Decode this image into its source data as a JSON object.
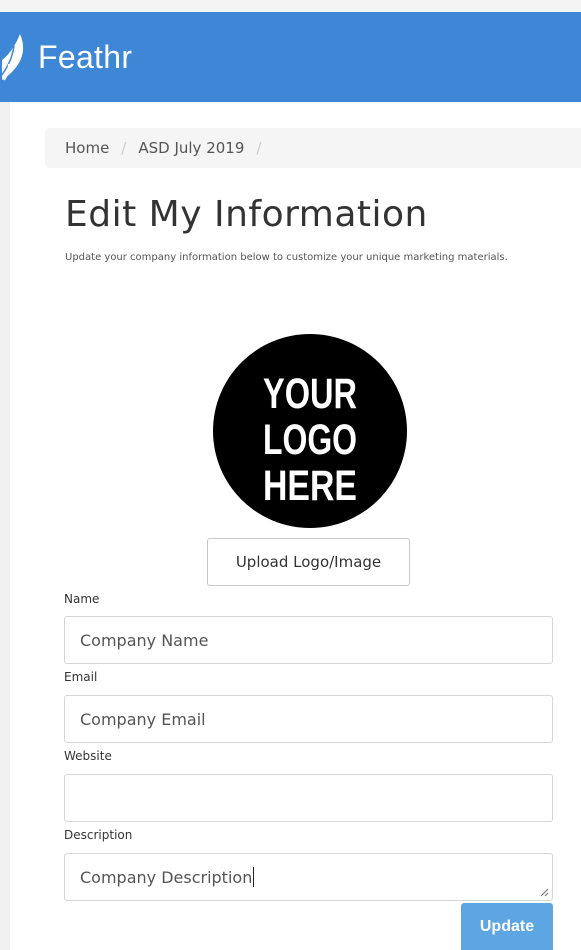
{
  "header": {
    "brand_name": "Feathr",
    "brand_color": "#3d87d6",
    "logo_icon": "feather-icon"
  },
  "breadcrumb": {
    "items": [
      "Home",
      "ASD July 2019"
    ],
    "separator": "/"
  },
  "main": {
    "title": "Edit My Information",
    "subtitle": "Update your company information below to customize your unique marketing materials.",
    "logo_placeholder_text": "YOUR LOGO HERE",
    "upload_button_label": "Upload Logo/Image"
  },
  "form": {
    "name": {
      "label": "Name",
      "value": "Company Name"
    },
    "email": {
      "label": "Email",
      "value": "Company Email"
    },
    "website": {
      "label": "Website",
      "value": ""
    },
    "description": {
      "label": "Description",
      "value": "Company Description"
    },
    "submit_label": "Update"
  }
}
